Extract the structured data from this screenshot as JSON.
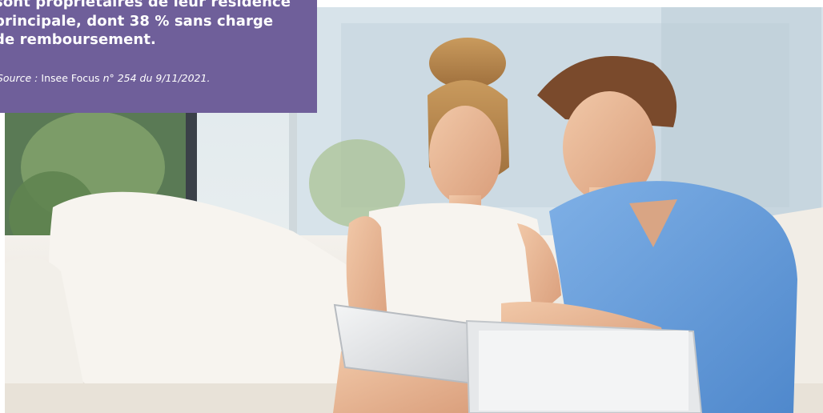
{
  "callout": {
    "line1": "sont propriétaires de leur résidence",
    "line2": "principale, dont 38 % sans charge",
    "line3": "de remboursement.",
    "source_label": "Source :",
    "source_name": "Insee Focus",
    "source_ref": "n° 254 du 9/11/2021.",
    "background_color": "#6f5f9a"
  },
  "photo": {
    "subject": "couple-with-tablet-and-laptop-on-sofa"
  }
}
